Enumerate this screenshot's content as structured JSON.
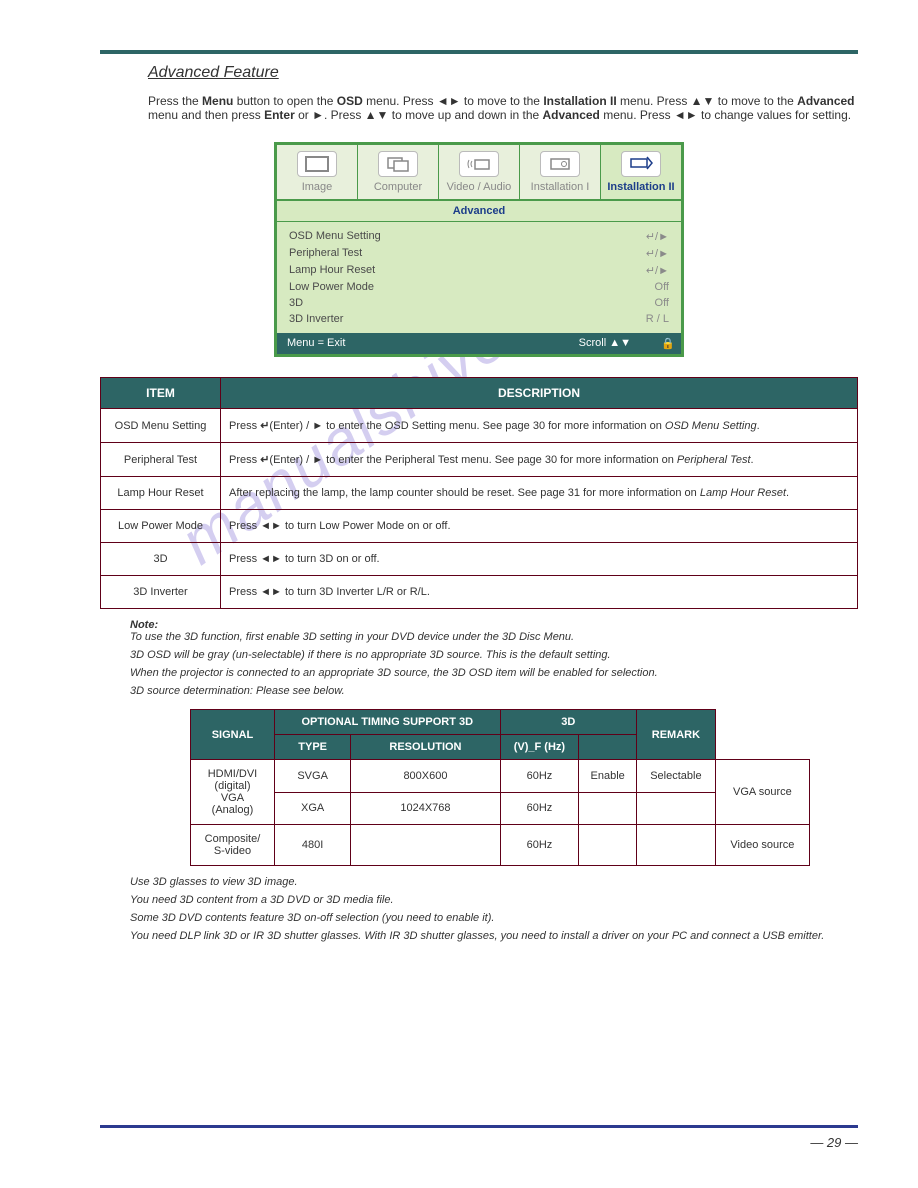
{
  "header": {
    "feature_title": "Advanced Feature",
    "intro_1": "Press the ",
    "intro_menu": "Menu",
    "intro_2": " button to open the ",
    "intro_osd": "OSD",
    "intro_3": " menu. Press ◄► to move to the ",
    "intro_inst": "Installation II",
    "intro_4": " menu. Press ▲▼ to move to the ",
    "intro_adv": "Advanced",
    "intro_5": " menu and then press ",
    "intro_enter": "Enter",
    "intro_6": " or ►. Press ▲▼ to move up and down in the ",
    "intro_adv2": "Advanced",
    "intro_7": " menu. Press ◄► to change values for setting."
  },
  "osd": {
    "tabs": [
      "Image",
      "Computer",
      "Video / Audio",
      "Installation I",
      "Installation II"
    ],
    "subtitle": "Advanced",
    "rows": [
      {
        "label": "OSD Menu Setting",
        "val": "↵/►"
      },
      {
        "label": "Peripheral Test",
        "val": "↵/►"
      },
      {
        "label": "Lamp Hour Reset",
        "val": "↵/►"
      },
      {
        "label": "Low Power Mode",
        "val": "Off"
      },
      {
        "label": "3D",
        "val": "Off"
      },
      {
        "label": "3D Inverter",
        "val": "R / L"
      }
    ],
    "status_left": "Menu = Exit",
    "status_right": "Scroll ▲▼"
  },
  "desc_table": {
    "head_item": "ITEM",
    "head_desc": "DESCRIPTION",
    "rows": [
      {
        "item": "OSD Menu Setting",
        "desc_pre": "Press ",
        "desc_enter": true,
        "desc_post": "(Enter) / ► to enter the OSD Setting menu. See page 30 for more information on ",
        "desc_ital": "OSD Menu Setting",
        "desc_end": "."
      },
      {
        "item": "Peripheral Test",
        "desc_pre": "Press ",
        "desc_enter": true,
        "desc_post": "(Enter) / ► to enter the Peripheral Test menu. See page 30 for more information on ",
        "desc_ital": "Peripheral Test",
        "desc_end": "."
      },
      {
        "item": "Lamp Hour Reset",
        "desc_pre": "After replacing the lamp, the lamp counter should be reset. See page 31 for more information on ",
        "desc_enter": false,
        "desc_post": "",
        "desc_ital": "Lamp Hour Reset",
        "desc_end": "."
      },
      {
        "item": "Low Power Mode",
        "desc_pre": "Press ◄► to turn Low Power Mode on or off.",
        "desc_enter": false,
        "desc_post": "",
        "desc_ital": "",
        "desc_end": ""
      },
      {
        "item": "3D",
        "desc_pre": "Press ◄► to turn 3D on or off.",
        "desc_enter": false,
        "desc_post": "",
        "desc_ital": "",
        "desc_end": ""
      },
      {
        "item": "3D Inverter",
        "desc_pre": "Press ◄► to turn 3D Inverter L/R or R/L.",
        "desc_enter": false,
        "desc_post": "",
        "desc_ital": "",
        "desc_end": ""
      }
    ]
  },
  "notes": {
    "note_label": "Note:",
    "note1": "To use the 3D function, first enable 3D setting in your DVD device under the 3D Disc Menu.",
    "note2": "3D OSD will be gray (un-selectable) if there is no appropriate 3D source. This is the default setting.",
    "note3": "When the projector is connected to an appropriate 3D source, the 3D OSD item will be enabled for selection.",
    "note4": "3D source determination: Please see below."
  },
  "threed_table": {
    "head_signal": "SIGNAL",
    "head_opt": "OPTIONAL TIMING SUPPORT 3D",
    "head_3d": "3D",
    "head_remark": "REMARK",
    "sub_type": "TYPE",
    "sub_res": "RESOLUTION",
    "sub_vf": "(V)_F (Hz)",
    "rows": [
      {
        "type": "SVGA",
        "res": "800X600",
        "vf": "60Hz",
        "enable": "Enable",
        "selectable": "Selectable",
        "remark": ""
      },
      {
        "type": "XGA",
        "res": "1024X768",
        "vf": "60Hz",
        "enable": "",
        "selectable": "",
        "remark": "VGA source"
      },
      {
        "type": "480I",
        "res": "",
        "vf": "60Hz",
        "enable": "",
        "selectable": "",
        "remark": "Video source"
      }
    ]
  },
  "note5": "Use 3D glasses to view 3D image.",
  "note6": "You need 3D content from a 3D DVD or 3D media file.",
  "note7": "Some 3D DVD contents feature 3D on-off selection (you need to enable it).",
  "note8": "You need DLP link 3D or IR 3D shutter glasses. With IR 3D shutter glasses, you need to install a driver on your PC and connect a USB emitter.",
  "footer": "— 29 —",
  "watermark": "manualshive.com"
}
